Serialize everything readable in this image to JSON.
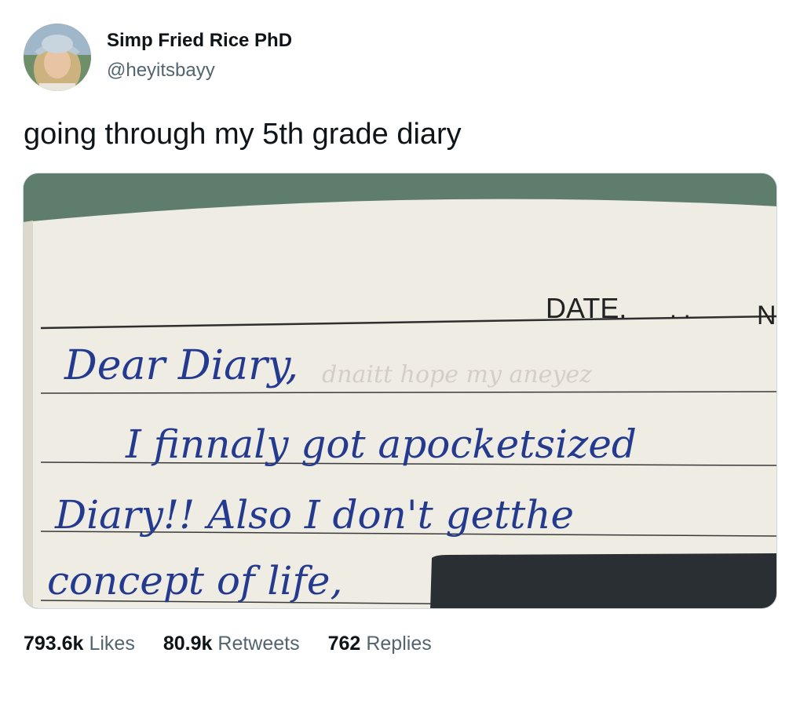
{
  "author": {
    "display_name": "Simp Fried Rice PhD",
    "handle": "@heyitsbayy"
  },
  "tweet": {
    "text": "going through my 5th grade diary"
  },
  "media": {
    "printed_label": "DATE.",
    "printed_label_right": "N",
    "handwriting": [
      "Dear Diary,",
      "I finnaly got apocketsized",
      "Diary!! Also I don't getthe",
      "concept of life,"
    ]
  },
  "stats": {
    "likes_count": "793.6k",
    "likes_label": "Likes",
    "retweets_count": "80.9k",
    "retweets_label": "Retweets",
    "replies_count": "762",
    "replies_label": "Replies"
  },
  "colors": {
    "text_primary": "#0f1419",
    "text_secondary": "#536471",
    "ink": "#243a8f",
    "paper": "#efece4",
    "background_green": "#5f7d6c",
    "redaction": "#2a2f34"
  }
}
